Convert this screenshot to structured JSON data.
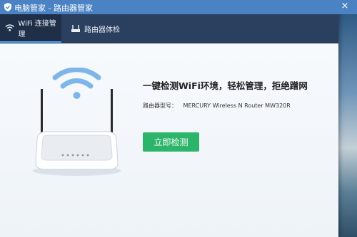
{
  "window": {
    "title": "电脑管家 - 路由器管家",
    "close_glyph": "×"
  },
  "tabs": [
    {
      "label": "WiFi 连接管理",
      "icon": "wifi-icon",
      "active": true
    },
    {
      "label": "路由器体检",
      "icon": "router-check-icon",
      "active": false
    }
  ],
  "main": {
    "headline": "一键检测WiFi环境，轻松管理，拒绝蹭网",
    "model_label": "路由器型号：",
    "model_value": "MERCURY Wireless N Router MW320R",
    "check_button_label": "立即检测"
  },
  "colors": {
    "titlebar": "#4a82c3",
    "tabbar": "#2b3f5f",
    "accent_green": "#2cb56a",
    "wifi_blue": "#7fb6ea"
  }
}
